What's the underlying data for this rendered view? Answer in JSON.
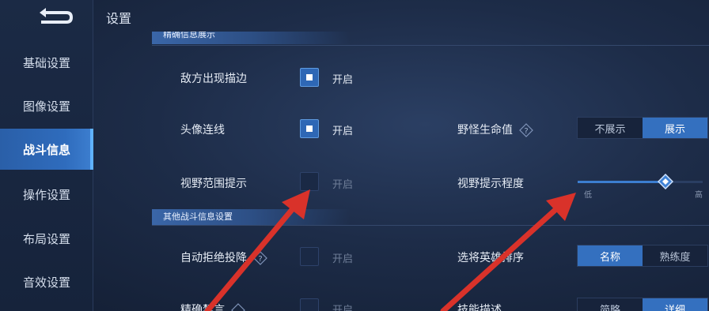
{
  "page": {
    "title": "设置"
  },
  "sidebar": {
    "items": [
      {
        "label": "基础设置",
        "active": false
      },
      {
        "label": "图像设置",
        "active": false
      },
      {
        "label": "战斗信息",
        "active": true
      },
      {
        "label": "操作设置",
        "active": false
      },
      {
        "label": "布局设置",
        "active": false
      },
      {
        "label": "音效设置",
        "active": false
      }
    ]
  },
  "sections": {
    "top_partial": "精确信息展示",
    "other": "其他战斗信息设置"
  },
  "settings": {
    "enemy_outline": {
      "label": "敌方出现描边",
      "option": "开启",
      "checked": true
    },
    "avatar_line": {
      "label": "头像连线",
      "option": "开启",
      "checked": true
    },
    "vision_hint": {
      "label": "视野范围提示",
      "option": "开启",
      "checked": false
    },
    "auto_reject": {
      "label": "自动拒绝投降",
      "option": "开启",
      "checked": false
    },
    "precise_mute": {
      "label": "精确禁言",
      "option": "开启",
      "checked": false
    },
    "monster_hp": {
      "label": "野怪生命值",
      "options": [
        "不展示",
        "展示"
      ],
      "selected": 1
    },
    "vision_level": {
      "label": "视野提示程度",
      "min_label": "低",
      "max_label": "高",
      "value": 0.7
    },
    "hero_sort": {
      "label": "选将英雄排序",
      "options": [
        "名称",
        "熟练度"
      ],
      "selected": 0
    },
    "skill_desc": {
      "label": "技能描述",
      "options": [
        "简略",
        "详细"
      ],
      "selected": 1
    }
  },
  "colors": {
    "accent": "#3470bf",
    "arrow": "#d9322a",
    "background": "#1d2c48"
  },
  "icons": {
    "back": "back-arrow-icon",
    "help": "help-diamond-icon"
  }
}
